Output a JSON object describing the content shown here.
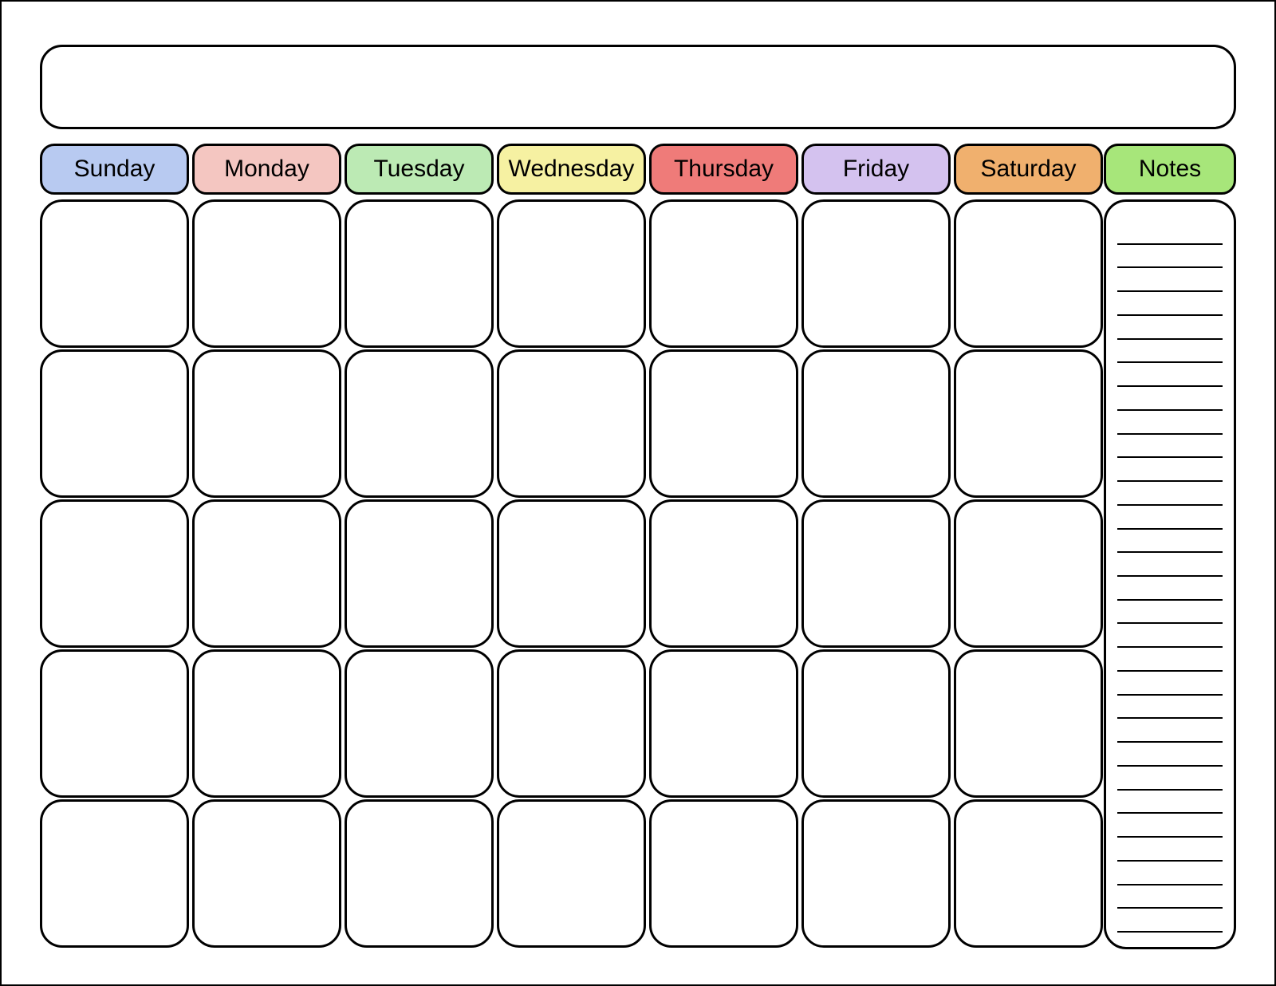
{
  "title": "",
  "days": [
    {
      "label": "Sunday",
      "color": "#b8caf1"
    },
    {
      "label": "Monday",
      "color": "#f4c6c1"
    },
    {
      "label": "Tuesday",
      "color": "#bceab4"
    },
    {
      "label": "Wednesday",
      "color": "#f6f1a2"
    },
    {
      "label": "Thursday",
      "color": "#ef7b79"
    },
    {
      "label": "Friday",
      "color": "#d4c2ef"
    },
    {
      "label": "Saturday",
      "color": "#f0b06e"
    }
  ],
  "notes": {
    "label": "Notes",
    "color": "#a7e67a",
    "line_count": 30
  },
  "grid": {
    "rows": 5,
    "cols": 7
  }
}
